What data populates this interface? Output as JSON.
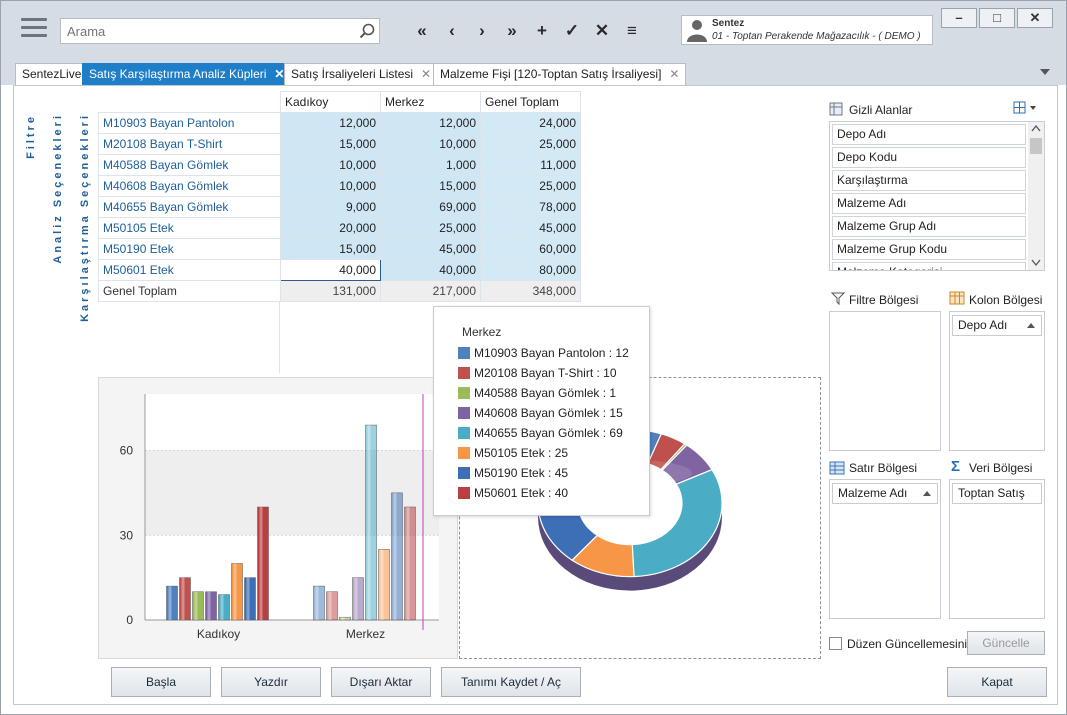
{
  "topbar": {
    "search_placeholder": "Arama",
    "nav_buttons": [
      "«",
      "‹",
      "›",
      "»",
      "+",
      "✓",
      "✕",
      "≡"
    ],
    "user": {
      "name": "Sentez",
      "company": "01 - Toptan Perakende Mağazacılık - ( DEMO )"
    },
    "window_buttons": [
      "–",
      "□",
      "✕"
    ]
  },
  "tabs": [
    {
      "label": "SentezLive"
    },
    {
      "label": "Satış Karşılaştırma Analiz Küpleri",
      "close": "✕"
    },
    {
      "label": "Satış İrsaliyeleri Listesi",
      "close": "✕"
    },
    {
      "label": "Malzeme Fişi  [120-Toptan Satış İrsaliyesi]",
      "close": "✕"
    }
  ],
  "side_labels": {
    "filtre": "Filtre",
    "analiz": "Analiz  Seçenekleri",
    "karsilastirma": "Karşılaştırma  Seçenekleri"
  },
  "pivot": {
    "columns": [
      "Kadıkoy",
      "Merkez",
      "Genel Toplam"
    ],
    "rows": [
      {
        "label": "M10903 Bayan Pantolon",
        "values": [
          "12,000",
          "12,000",
          "24,000"
        ]
      },
      {
        "label": "M20108 Bayan T-Shirt",
        "values": [
          "15,000",
          "10,000",
          "25,000"
        ]
      },
      {
        "label": "M40588 Bayan Gömlek",
        "values": [
          "10,000",
          "1,000",
          "11,000"
        ]
      },
      {
        "label": "M40608 Bayan Gömlek",
        "values": [
          "10,000",
          "15,000",
          "25,000"
        ]
      },
      {
        "label": "M40655 Bayan Gömlek",
        "values": [
          "9,000",
          "69,000",
          "78,000"
        ]
      },
      {
        "label": "M50105 Etek",
        "values": [
          "20,000",
          "25,000",
          "45,000"
        ]
      },
      {
        "label": "M50190 Etek",
        "values": [
          "15,000",
          "45,000",
          "60,000"
        ]
      },
      {
        "label": "M50601 Etek",
        "values": [
          "40,000",
          "40,000",
          "80,000"
        ]
      }
    ],
    "total": {
      "label": "Genel Toplam",
      "values": [
        "131,000",
        "217,000",
        "348,000"
      ]
    }
  },
  "chart_data": {
    "type": "bar",
    "categories": [
      "Kadıkoy",
      "Merkez"
    ],
    "ylim": [
      0,
      80
    ],
    "yticks": [
      "0",
      "30",
      "60"
    ],
    "series": [
      {
        "name": "M10903 Bayan Pantolon",
        "color": "#4f81bd",
        "values": [
          12,
          12
        ]
      },
      {
        "name": "M20108 Bayan T-Shirt",
        "color": "#c0504d",
        "values": [
          15,
          10
        ]
      },
      {
        "name": "M40588 Bayan Gömlek",
        "color": "#9bbb59",
        "values": [
          10,
          1
        ]
      },
      {
        "name": "M40608 Bayan Gömlek",
        "color": "#8064a2",
        "values": [
          10,
          15
        ]
      },
      {
        "name": "M40655 Bayan Gömlek",
        "color": "#4bacc6",
        "values": [
          9,
          69
        ]
      },
      {
        "name": "M50105 Etek",
        "color": "#f79646",
        "values": [
          20,
          25
        ]
      },
      {
        "name": "M50190 Etek",
        "color": "#3d6fb6",
        "values": [
          15,
          45
        ]
      },
      {
        "name": "M50601 Etek",
        "color": "#b94040",
        "values": [
          40,
          40
        ]
      }
    ]
  },
  "pie_legend": {
    "title": "Merkez",
    "items": [
      {
        "label": "M10903 Bayan Pantolon : 12",
        "color": "#4f81bd"
      },
      {
        "label": "M20108 Bayan T-Shirt : 10",
        "color": "#c0504d"
      },
      {
        "label": "M40588 Bayan Gömlek : 1",
        "color": "#9bbb59"
      },
      {
        "label": "M40608 Bayan Gömlek : 15",
        "color": "#8064a2"
      },
      {
        "label": "M40655 Bayan Gömlek : 69",
        "color": "#4bacc6"
      },
      {
        "label": "M50105 Etek : 25",
        "color": "#f79646"
      },
      {
        "label": "M50190 Etek : 45",
        "color": "#3d6fb6"
      },
      {
        "label": "M50601 Etek : 40",
        "color": "#b94040"
      }
    ]
  },
  "right_panel": {
    "hidden_fields_title": "Gizli Alanlar",
    "hidden_fields": [
      "Depo Adı",
      "Depo Kodu",
      "Karşılaştırma",
      "Malzeme Adı",
      "Malzeme Grup Adı",
      "Malzeme Grup Kodu",
      "Malzeme Kategorisi"
    ],
    "filter_area": "Filtre Bölgesi",
    "column_area": "Kolon Bölgesi",
    "column_chip": "Depo Adı",
    "row_area": "Satır Bölgesi",
    "row_chip": "Malzeme Adı",
    "data_area": "Veri Bölgesi",
    "data_chip": "Toptan Satış",
    "defer_label": "Düzen Güncellemesini Ertele",
    "update_button": "Güncelle"
  },
  "buttons": {
    "start": "Başla",
    "print": "Yazdır",
    "export": "Dışarı Aktar",
    "save_def": "Tanımı Kaydet  / Aç",
    "close": "Kapat"
  }
}
